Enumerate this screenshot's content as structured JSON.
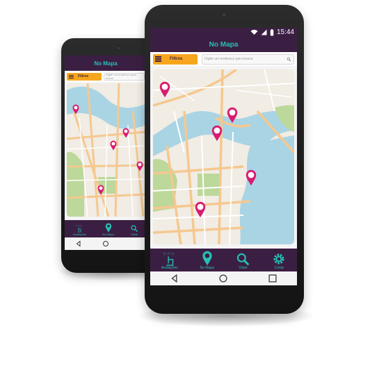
{
  "status": {
    "time": "15:44"
  },
  "header": {
    "title": "No Mapa"
  },
  "filter": {
    "label": "Filtros"
  },
  "search": {
    "placeholder": "Digite um endereço para busca"
  },
  "tabs": [
    {
      "label": "Avaliações",
      "icon": "rating-hand-icon"
    },
    {
      "label": "No Mapa",
      "icon": "map-pin-icon"
    },
    {
      "label": "Visite",
      "icon": "search-icon"
    },
    {
      "label": "Conta",
      "icon": "gear-icon"
    }
  ],
  "colors": {
    "header": "#3b1f43",
    "accent": "#25c0b4",
    "filter": "#f6a61e",
    "pin": "#d81b72",
    "water": "#a9d4e4",
    "park": "#bcd89a",
    "road": "#f5c88f"
  }
}
